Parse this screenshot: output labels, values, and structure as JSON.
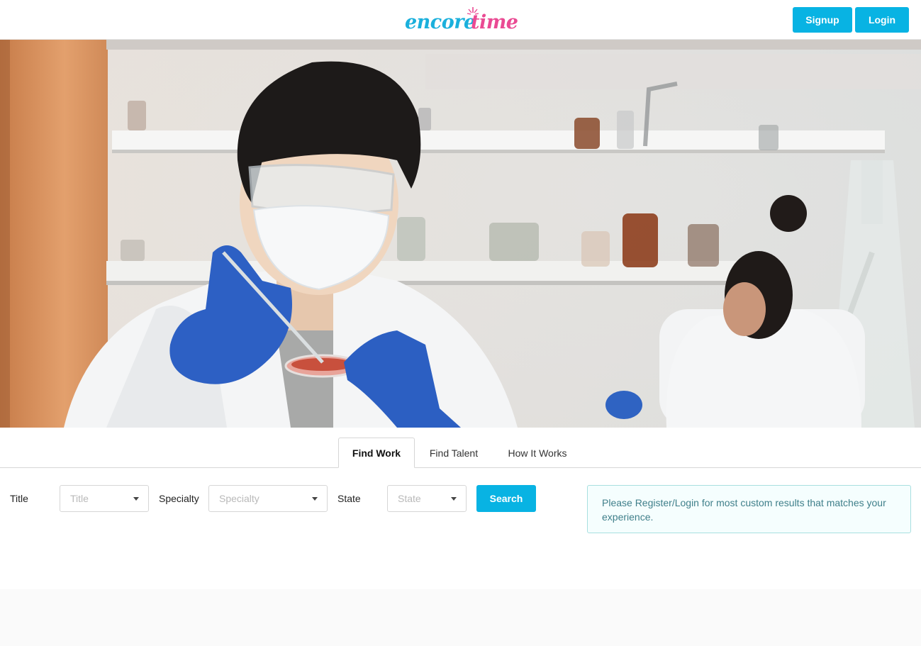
{
  "header": {
    "logo": {
      "word1": "encore",
      "word2": "time",
      "color1": "#1ab0dc",
      "color2": "#ea4a93"
    },
    "signup_label": "Signup",
    "login_label": "Login",
    "accent": "#08b3e3"
  },
  "tabs": [
    {
      "label": "Find Work",
      "active": true
    },
    {
      "label": "Find Talent",
      "active": false
    },
    {
      "label": "How It Works",
      "active": false
    }
  ],
  "filters": {
    "title": {
      "label": "Title",
      "placeholder": "Title"
    },
    "specialty": {
      "label": "Specialty",
      "placeholder": "Specialty"
    },
    "state": {
      "label": "State",
      "placeholder": "State"
    },
    "search_label": "Search"
  },
  "notice": {
    "text": "Please Register/Login for most custom results that matches your experience."
  }
}
